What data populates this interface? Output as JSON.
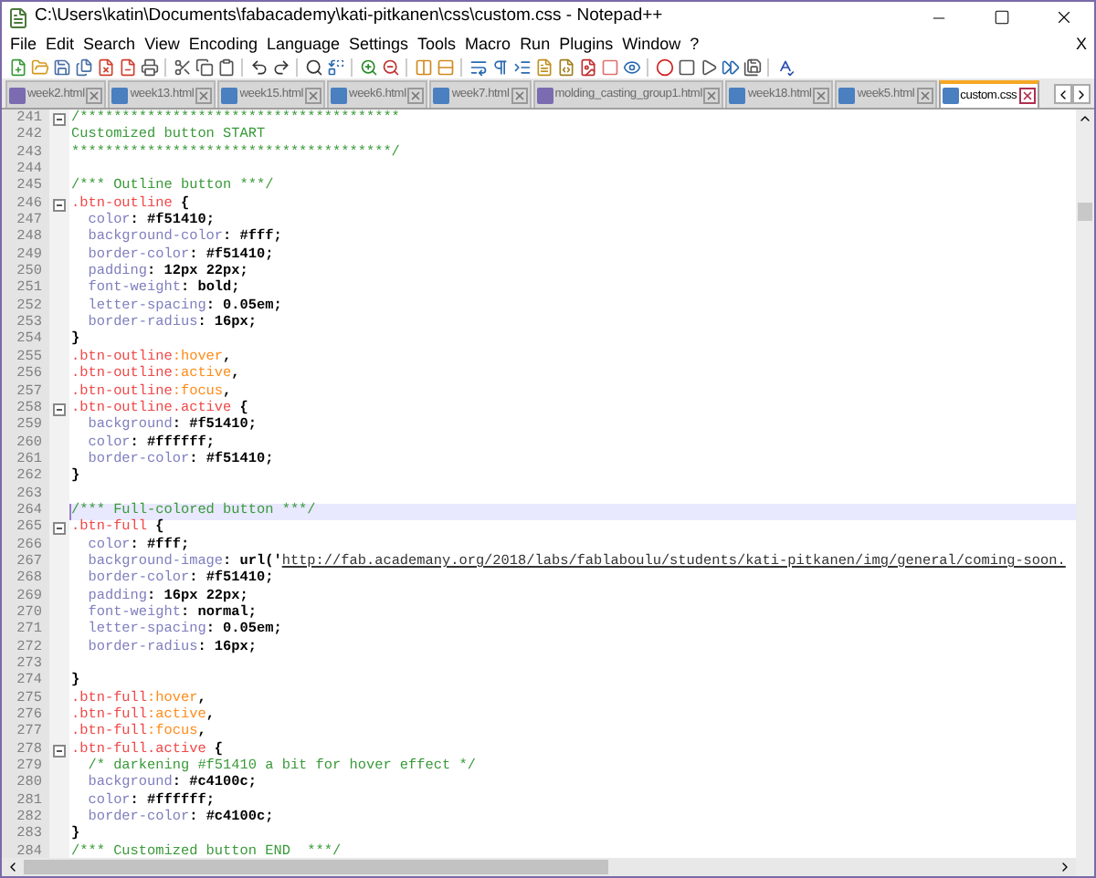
{
  "window": {
    "title": "C:\\Users\\katin\\Documents\\fabacademy\\kati-pitkanen\\css\\custom.css - Notepad++"
  },
  "menu": [
    "File",
    "Edit",
    "Search",
    "View",
    "Encoding",
    "Language",
    "Settings",
    "Tools",
    "Macro",
    "Run",
    "Plugins",
    "Window",
    "?"
  ],
  "menu_close": "X",
  "tabs": [
    {
      "label": "week2.html",
      "selected": false,
      "color": "#7b6bb0"
    },
    {
      "label": "week13.html",
      "selected": false,
      "color": "#4a7fc0"
    },
    {
      "label": "week15.html",
      "selected": false,
      "color": "#4a7fc0"
    },
    {
      "label": "week6.html",
      "selected": false,
      "color": "#4a7fc0"
    },
    {
      "label": "week7.html",
      "selected": false,
      "color": "#4a7fc0"
    },
    {
      "label": "molding_casting_group1.html",
      "selected": false,
      "color": "#7b6bb0"
    },
    {
      "label": "week18.html",
      "selected": false,
      "color": "#4a7fc0"
    },
    {
      "label": "week5.html",
      "selected": false,
      "color": "#4a7fc0"
    },
    {
      "label": "custom.css",
      "selected": true,
      "color": "#4a7fc0"
    }
  ],
  "editor": {
    "lines": [
      {
        "number": "241",
        "fold": true,
        "current": false,
        "tokens": [
          {
            "kind": "comment",
            "text": "/**************************************"
          }
        ]
      },
      {
        "number": "242",
        "fold": false,
        "current": false,
        "tokens": [
          {
            "kind": "comment",
            "text": "Customized button START"
          }
        ]
      },
      {
        "number": "243",
        "fold": false,
        "current": false,
        "tokens": [
          {
            "kind": "comment",
            "text": "**************************************/"
          }
        ]
      },
      {
        "number": "244",
        "fold": false,
        "current": false
      },
      {
        "number": "245",
        "fold": false,
        "current": false,
        "tokens": [
          {
            "kind": "comment",
            "text": "/*** Outline button ***/"
          }
        ]
      },
      {
        "number": "246",
        "fold": true,
        "current": false,
        "tokens": [
          {
            "kind": "selector",
            "text": ".btn-outline"
          },
          {
            "kind": "value",
            "text": " {"
          }
        ]
      },
      {
        "number": "247",
        "fold": false,
        "current": false,
        "tokens": [
          {
            "kind": "property",
            "text": "  color"
          },
          {
            "kind": "value",
            "text": ": #f51410;"
          }
        ]
      },
      {
        "number": "248",
        "fold": false,
        "current": false,
        "tokens": [
          {
            "kind": "property",
            "text": "  background-color"
          },
          {
            "kind": "value",
            "text": ": #fff;"
          }
        ]
      },
      {
        "number": "249",
        "fold": false,
        "current": false,
        "tokens": [
          {
            "kind": "property",
            "text": "  border-color"
          },
          {
            "kind": "value",
            "text": ": #f51410;"
          }
        ]
      },
      {
        "number": "250",
        "fold": false,
        "current": false,
        "tokens": [
          {
            "kind": "property",
            "text": "  padding"
          },
          {
            "kind": "value",
            "text": ": 12px 22px;"
          }
        ]
      },
      {
        "number": "251",
        "fold": false,
        "current": false,
        "tokens": [
          {
            "kind": "property",
            "text": "  font-weight"
          },
          {
            "kind": "value",
            "text": ": bold;"
          }
        ]
      },
      {
        "number": "252",
        "fold": false,
        "current": false,
        "tokens": [
          {
            "kind": "property",
            "text": "  letter-spacing"
          },
          {
            "kind": "value",
            "text": ": 0.05em;"
          }
        ]
      },
      {
        "number": "253",
        "fold": false,
        "current": false,
        "tokens": [
          {
            "kind": "property",
            "text": "  border-radius"
          },
          {
            "kind": "value",
            "text": ": 16px;"
          }
        ]
      },
      {
        "number": "254",
        "fold": false,
        "current": false,
        "tokens": [
          {
            "kind": "value",
            "text": "}"
          }
        ]
      },
      {
        "number": "255",
        "fold": false,
        "current": false,
        "tokens": [
          {
            "kind": "selector",
            "text": ".btn-outline"
          },
          {
            "kind": "pseudo",
            "text": ":hover"
          },
          {
            "kind": "value",
            "text": ","
          }
        ]
      },
      {
        "number": "256",
        "fold": false,
        "current": false,
        "tokens": [
          {
            "kind": "selector",
            "text": ".btn-outline"
          },
          {
            "kind": "pseudo",
            "text": ":active"
          },
          {
            "kind": "value",
            "text": ","
          }
        ]
      },
      {
        "number": "257",
        "fold": false,
        "current": false,
        "tokens": [
          {
            "kind": "selector",
            "text": ".btn-outline"
          },
          {
            "kind": "pseudo",
            "text": ":focus"
          },
          {
            "kind": "value",
            "text": ","
          }
        ]
      },
      {
        "number": "258",
        "fold": true,
        "current": false,
        "tokens": [
          {
            "kind": "selector",
            "text": ".btn-outline.active"
          },
          {
            "kind": "value",
            "text": " {"
          }
        ]
      },
      {
        "number": "259",
        "fold": false,
        "current": false,
        "tokens": [
          {
            "kind": "property",
            "text": "  background"
          },
          {
            "kind": "value",
            "text": ": #f51410;"
          }
        ]
      },
      {
        "number": "260",
        "fold": false,
        "current": false,
        "tokens": [
          {
            "kind": "property",
            "text": "  color"
          },
          {
            "kind": "value",
            "text": ": #ffffff;"
          }
        ]
      },
      {
        "number": "261",
        "fold": false,
        "current": false,
        "tokens": [
          {
            "kind": "property",
            "text": "  border-color"
          },
          {
            "kind": "value",
            "text": ": #f51410;"
          }
        ]
      },
      {
        "number": "262",
        "fold": false,
        "current": false,
        "tokens": [
          {
            "kind": "value",
            "text": "}"
          }
        ]
      },
      {
        "number": "263",
        "fold": false,
        "current": false
      },
      {
        "number": "264",
        "fold": false,
        "current": true,
        "tokens": [
          {
            "kind": "comment",
            "text": "/*** Full-colored button ***/"
          }
        ]
      },
      {
        "number": "265",
        "fold": true,
        "current": false,
        "tokens": [
          {
            "kind": "selector",
            "text": ".btn-full"
          },
          {
            "kind": "value",
            "text": " {"
          }
        ]
      },
      {
        "number": "266",
        "fold": false,
        "current": false,
        "tokens": [
          {
            "kind": "property",
            "text": "  color"
          },
          {
            "kind": "value",
            "text": ": #fff;"
          }
        ]
      },
      {
        "number": "267",
        "fold": false,
        "current": false,
        "tokens": [
          {
            "kind": "property",
            "text": "  background-image"
          },
          {
            "kind": "value",
            "text": ": url('"
          },
          {
            "kind": "url",
            "text": "http://fab.academany.org/2018/labs/fablaboulu/students/kati-pitkanen/img/general/coming-soon."
          }
        ]
      },
      {
        "number": "268",
        "fold": false,
        "current": false,
        "tokens": [
          {
            "kind": "property",
            "text": "  border-color"
          },
          {
            "kind": "value",
            "text": ": #f51410;"
          }
        ]
      },
      {
        "number": "269",
        "fold": false,
        "current": false,
        "tokens": [
          {
            "kind": "property",
            "text": "  padding"
          },
          {
            "kind": "value",
            "text": ": 16px 22px;"
          }
        ]
      },
      {
        "number": "270",
        "fold": false,
        "current": false,
        "tokens": [
          {
            "kind": "property",
            "text": "  font-weight"
          },
          {
            "kind": "value",
            "text": ": normal;"
          }
        ]
      },
      {
        "number": "271",
        "fold": false,
        "current": false,
        "tokens": [
          {
            "kind": "property",
            "text": "  letter-spacing"
          },
          {
            "kind": "value",
            "text": ": 0.05em;"
          }
        ]
      },
      {
        "number": "272",
        "fold": false,
        "current": false,
        "tokens": [
          {
            "kind": "property",
            "text": "  border-radius"
          },
          {
            "kind": "value",
            "text": ": 16px;"
          }
        ]
      },
      {
        "number": "273",
        "fold": false,
        "current": false
      },
      {
        "number": "274",
        "fold": false,
        "current": false,
        "tokens": [
          {
            "kind": "value",
            "text": "}"
          }
        ]
      },
      {
        "number": "275",
        "fold": false,
        "current": false,
        "tokens": [
          {
            "kind": "selector",
            "text": ".btn-full"
          },
          {
            "kind": "pseudo",
            "text": ":hover"
          },
          {
            "kind": "value",
            "text": ","
          }
        ]
      },
      {
        "number": "276",
        "fold": false,
        "current": false,
        "tokens": [
          {
            "kind": "selector",
            "text": ".btn-full"
          },
          {
            "kind": "pseudo",
            "text": ":active"
          },
          {
            "kind": "value",
            "text": ","
          }
        ]
      },
      {
        "number": "277",
        "fold": false,
        "current": false,
        "tokens": [
          {
            "kind": "selector",
            "text": ".btn-full"
          },
          {
            "kind": "pseudo",
            "text": ":focus"
          },
          {
            "kind": "value",
            "text": ","
          }
        ]
      },
      {
        "number": "278",
        "fold": true,
        "current": false,
        "tokens": [
          {
            "kind": "selector",
            "text": ".btn-full.active"
          },
          {
            "kind": "value",
            "text": " {"
          }
        ]
      },
      {
        "number": "279",
        "fold": false,
        "current": false,
        "tokens": [
          {
            "kind": "comment",
            "text": "  /* darkening #f51410 a bit for hover effect */"
          }
        ]
      },
      {
        "number": "280",
        "fold": false,
        "current": false,
        "tokens": [
          {
            "kind": "property",
            "text": "  background"
          },
          {
            "kind": "value",
            "text": ": #c4100c;"
          }
        ]
      },
      {
        "number": "281",
        "fold": false,
        "current": false,
        "tokens": [
          {
            "kind": "property",
            "text": "  color"
          },
          {
            "kind": "value",
            "text": ": #ffffff;"
          }
        ]
      },
      {
        "number": "282",
        "fold": false,
        "current": false,
        "tokens": [
          {
            "kind": "property",
            "text": "  border-color"
          },
          {
            "kind": "value",
            "text": ": #c4100c;"
          }
        ]
      },
      {
        "number": "283",
        "fold": false,
        "current": false,
        "tokens": [
          {
            "kind": "value",
            "text": "}"
          }
        ]
      },
      {
        "number": "284",
        "fold": false,
        "current": false,
        "tokens": [
          {
            "kind": "comment",
            "text": "/*** Customized button END  ***/"
          }
        ]
      }
    ]
  }
}
